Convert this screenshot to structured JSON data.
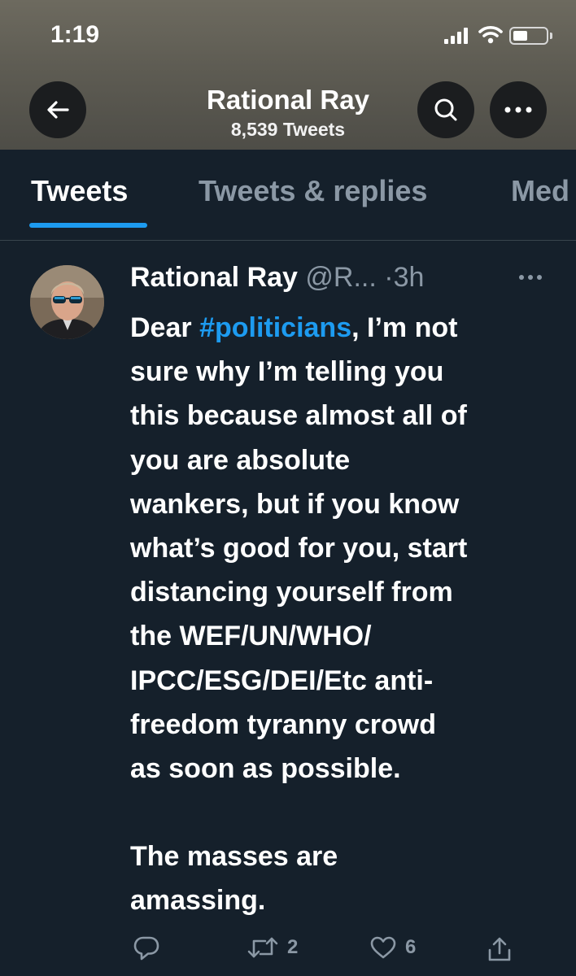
{
  "status_bar": {
    "time": "1:19"
  },
  "header": {
    "profile_name": "Rational Ray",
    "tweet_count": "8,539 Tweets"
  },
  "tabs": [
    {
      "label": "Tweets",
      "active": true
    },
    {
      "label": "Tweets & replies",
      "active": false
    },
    {
      "label": "Med",
      "active": false
    }
  ],
  "tweet": {
    "author_name": "Rational Ray",
    "handle": "@R...",
    "separator": "·",
    "time": "3h",
    "body": {
      "line1_prefix": "Dear ",
      "hashtag": "#politicians",
      "line1_suffix": ", I’m not",
      "lines": [
        "sure why I’m telling you",
        "this because almost all of",
        "you are absolute",
        "wankers, but if you know",
        "what’s good for you, start",
        "distancing yourself from",
        "the WEF/UN/WHO/",
        "IPCC/ESG/DEI/Etc anti-",
        "freedom tyranny crowd",
        "as soon as possible.",
        "",
        "The masses are",
        "amassing."
      ]
    },
    "actions": {
      "reply_icon": "reply-icon",
      "retweet_count": "2",
      "like_count": "6",
      "share_icon": "share-icon"
    }
  },
  "colors": {
    "background": "#15202b",
    "accent": "#1d9bf0",
    "muted": "#8b98a5"
  }
}
